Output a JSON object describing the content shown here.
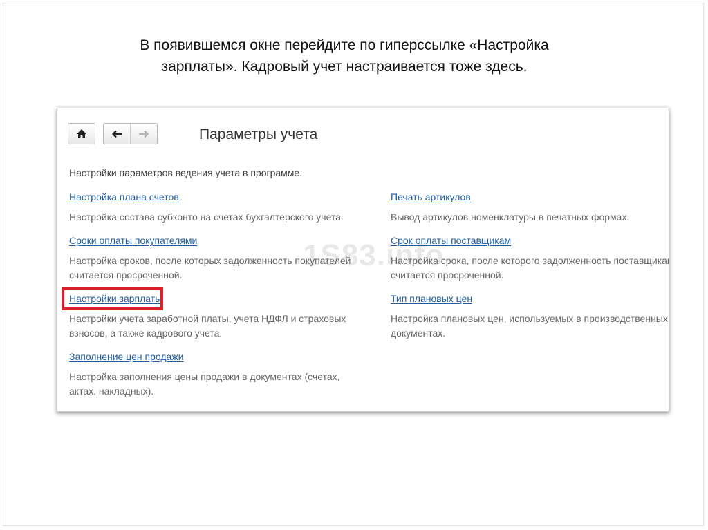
{
  "caption": {
    "line1": "В появившемся окне перейдите по гиперссылке «Настройка",
    "line2": "зарплаты». Кадровый учет настраивается тоже здесь."
  },
  "window": {
    "title": "Параметры учета",
    "intro": "Настройки параметров ведения учета в программе.",
    "watermark": "1S83.info",
    "highlight_color": "#d9202a",
    "toolbar": {
      "home_icon": "home-icon",
      "back_icon": "arrow-left-icon",
      "forward_icon": "arrow-right-icon"
    },
    "left_column": [
      {
        "link": "Настройка плана счетов",
        "desc": [
          "Настройка состава субконто на счетах бухгалтерского учета."
        ]
      },
      {
        "link": "Сроки оплаты покупателями",
        "desc": [
          "Настройка сроков, после которых задолженность покупателей",
          "считается просроченной."
        ]
      },
      {
        "link": "Настройки зарплаты",
        "desc": [
          "Настройки учета заработной платы, учета НДФЛ и страховых",
          "взносов, а также кадрового учета."
        ]
      },
      {
        "link": "Заполнение цен продажи",
        "desc": [
          "Настройка заполнения цены продажи в документах (счетах,",
          "актах, накладных)."
        ]
      }
    ],
    "right_column": [
      {
        "link": "Печать артикулов",
        "desc": [
          "Вывод артикулов номенклатуры в печатных формах."
        ]
      },
      {
        "link": "Срок оплаты поставщикам",
        "desc": [
          "Настройка срока, после которого задолженность поставщикам",
          "считается просроченной."
        ]
      },
      {
        "link": "Тип плановых цен",
        "desc": [
          "Настройка плановых цен, используемых в производственных",
          "документах."
        ]
      }
    ]
  }
}
